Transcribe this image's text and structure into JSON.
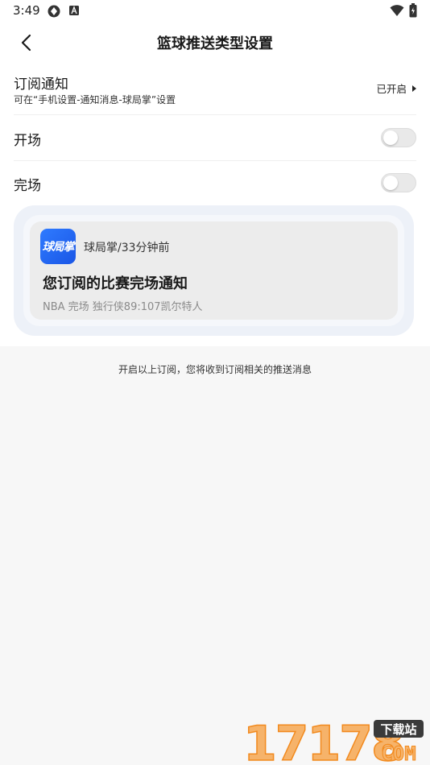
{
  "status_bar": {
    "time": "3:49"
  },
  "header": {
    "title": "篮球推送类型设置"
  },
  "subscribe": {
    "title": "订阅通知",
    "subtitle": "可在“手机设置-通知消息-球局掌”设置",
    "status": "已开启"
  },
  "toggles": [
    {
      "label": "开场",
      "on": false
    },
    {
      "label": "完场",
      "on": false
    }
  ],
  "preview": {
    "app_icon_text": "球局掌",
    "meta": "球局掌/33分钟前",
    "title": "您订阅的比赛完场通知",
    "body": "NBA 完场 独行侠89:107凯尔特人"
  },
  "footer_hint": "开启以上订阅，您将收到订阅相关的推送消息",
  "watermark": {
    "number": "17178",
    "tag": "下载站",
    "domain": "COM"
  },
  "colors": {
    "accent_blue": "#2f7bff",
    "toggle_off": "#e9e9e9",
    "background": "#f7f7f7",
    "watermark_orange": "#f28a1e"
  }
}
